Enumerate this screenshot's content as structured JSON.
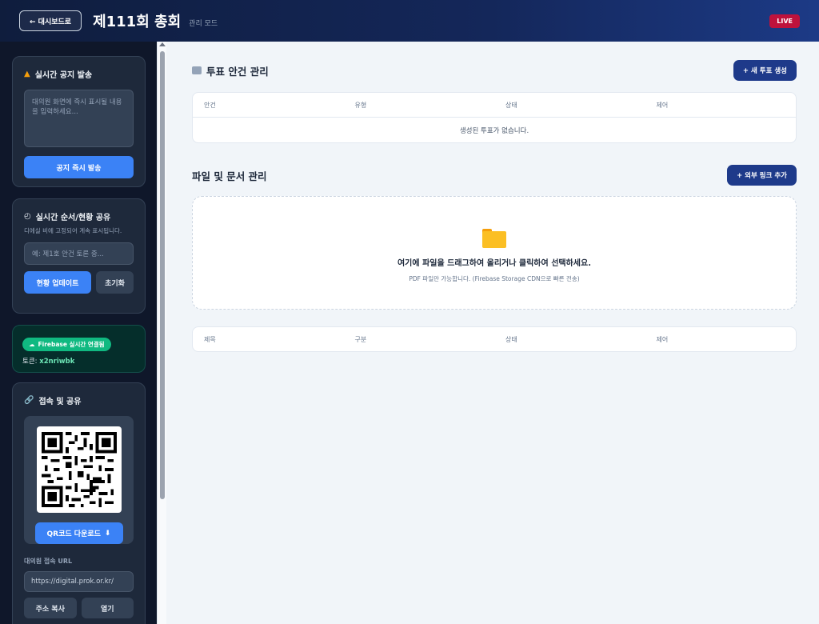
{
  "header": {
    "back_label": "← 대시보드로",
    "title": "제111회 총회",
    "mode": "관리 모드",
    "live_badge": "LIVE"
  },
  "sidebar": {
    "notice": {
      "title": "실시간 공지 발송",
      "placeholder": "대의원 화면에 즉시 표시될 내용을 입력하세요...",
      "send_label": "공지 즉시 발송"
    },
    "status": {
      "title": "실시간 순서/현황 공유",
      "description": "디에실 비에 고정되어 계속 표시됩니다.",
      "placeholder": "예: 제1호 안건 토론 중...",
      "update_label": "현황 업데이트",
      "reset_label": "초기화"
    },
    "firebase": {
      "badge": "Firebase 실시간 연결됨",
      "token_label": "토큰:",
      "token_value": "x2nriwbk"
    },
    "share": {
      "title": "접속 및 공유",
      "qr_download_label": "QR코드 다운로드",
      "url_label": "대의원 접속 URL",
      "url_value": "https://digital.prok.or.kr/",
      "copy_label": "주소 복사",
      "open_label": "열기"
    }
  },
  "main": {
    "votes": {
      "title": "투표 안건 관리",
      "new_label": "+ 새 투표 생성",
      "columns": [
        "안건",
        "유형",
        "상태",
        "제어"
      ],
      "empty": "생성된 투표가 없습니다."
    },
    "files": {
      "title": "파일 및 문서 관리",
      "add_link_label": "+ 외부 링크 추가",
      "drop_main": "여기에 파일을 드래그하여 올리거나 클릭하여 선택하세요.",
      "drop_sub": "PDF 파일만 가능합니다. (Firebase Storage CDN으로 빠른 전송)",
      "columns": [
        "제목",
        "구분",
        "상태",
        "제어"
      ]
    }
  },
  "colors": {
    "accent_blue": "#3b82f6",
    "navy": "#1e3a8a",
    "live_red": "#be123c",
    "success_green": "#10b981"
  }
}
